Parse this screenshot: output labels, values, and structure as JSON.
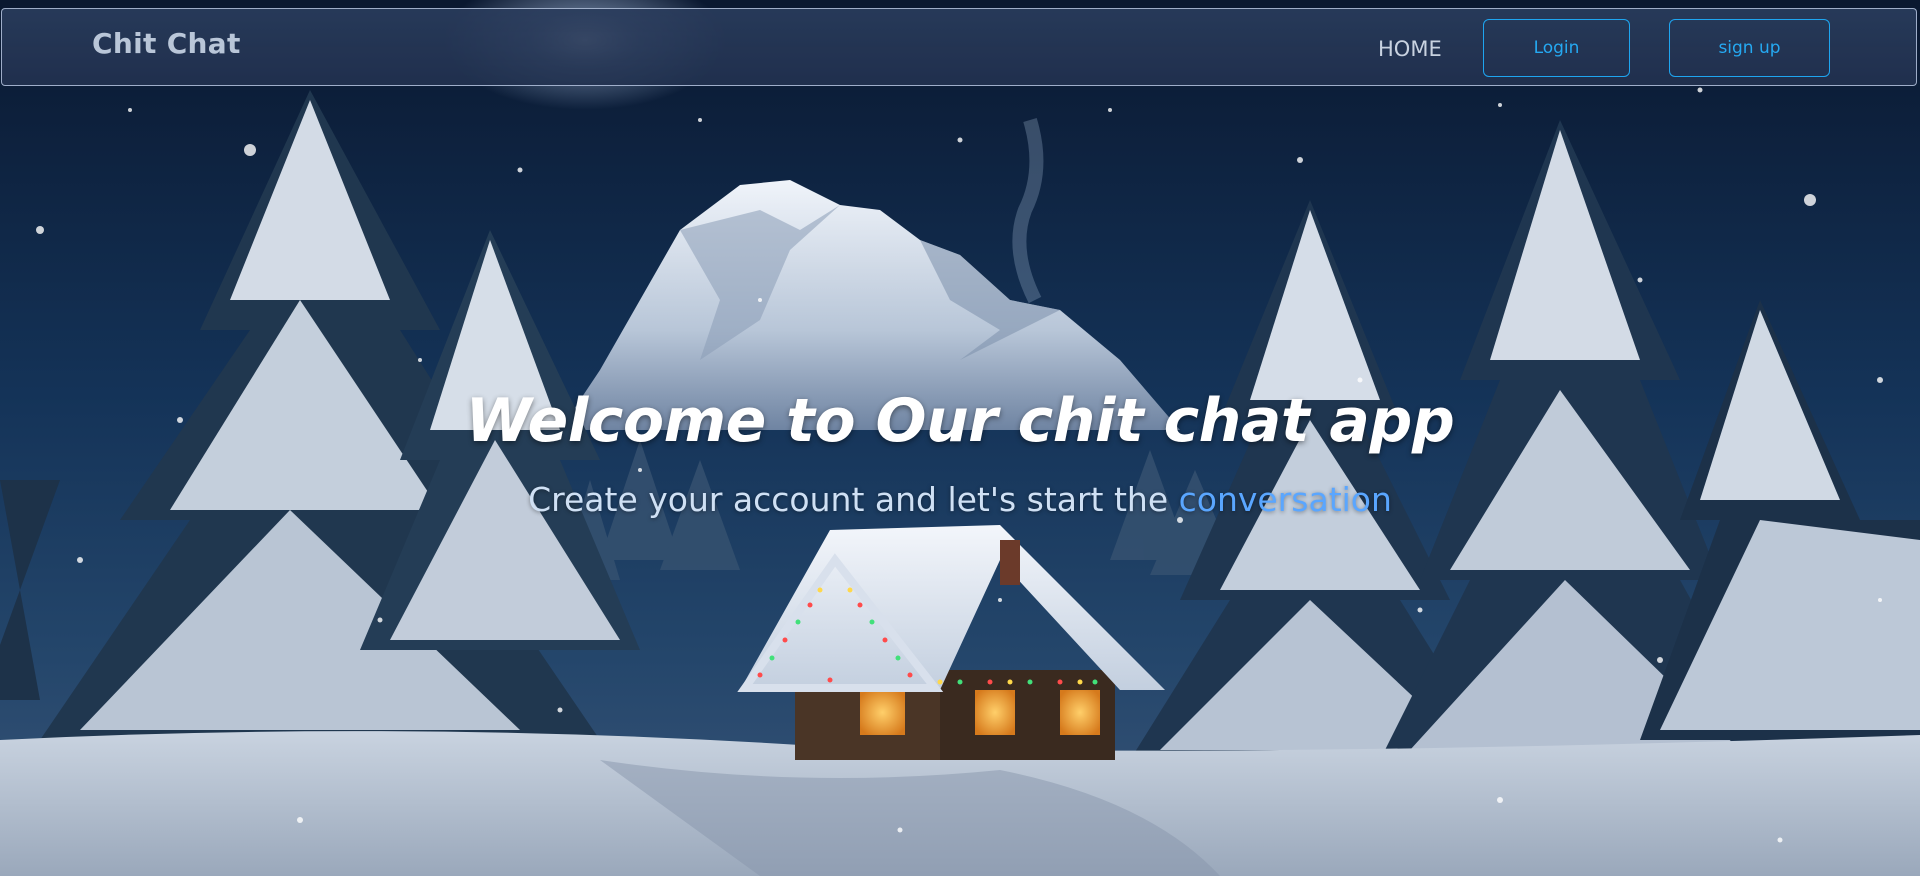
{
  "navbar": {
    "brand": "Chit Chat",
    "home_label": "HOME",
    "login_label": "Login",
    "signup_label": "sign up"
  },
  "hero": {
    "headline": "Welcome to Our chit chat app",
    "subline_prefix": "Create your account and let's start the ",
    "subline_accent": "conversation",
    "background_scene": "snowy-night-cabin-mountain"
  },
  "colors": {
    "accent": "#1ea5f0",
    "link_accent": "#5aa6ff",
    "navbar_bg": "#2a3c5c",
    "sky": "#0b1a33"
  }
}
